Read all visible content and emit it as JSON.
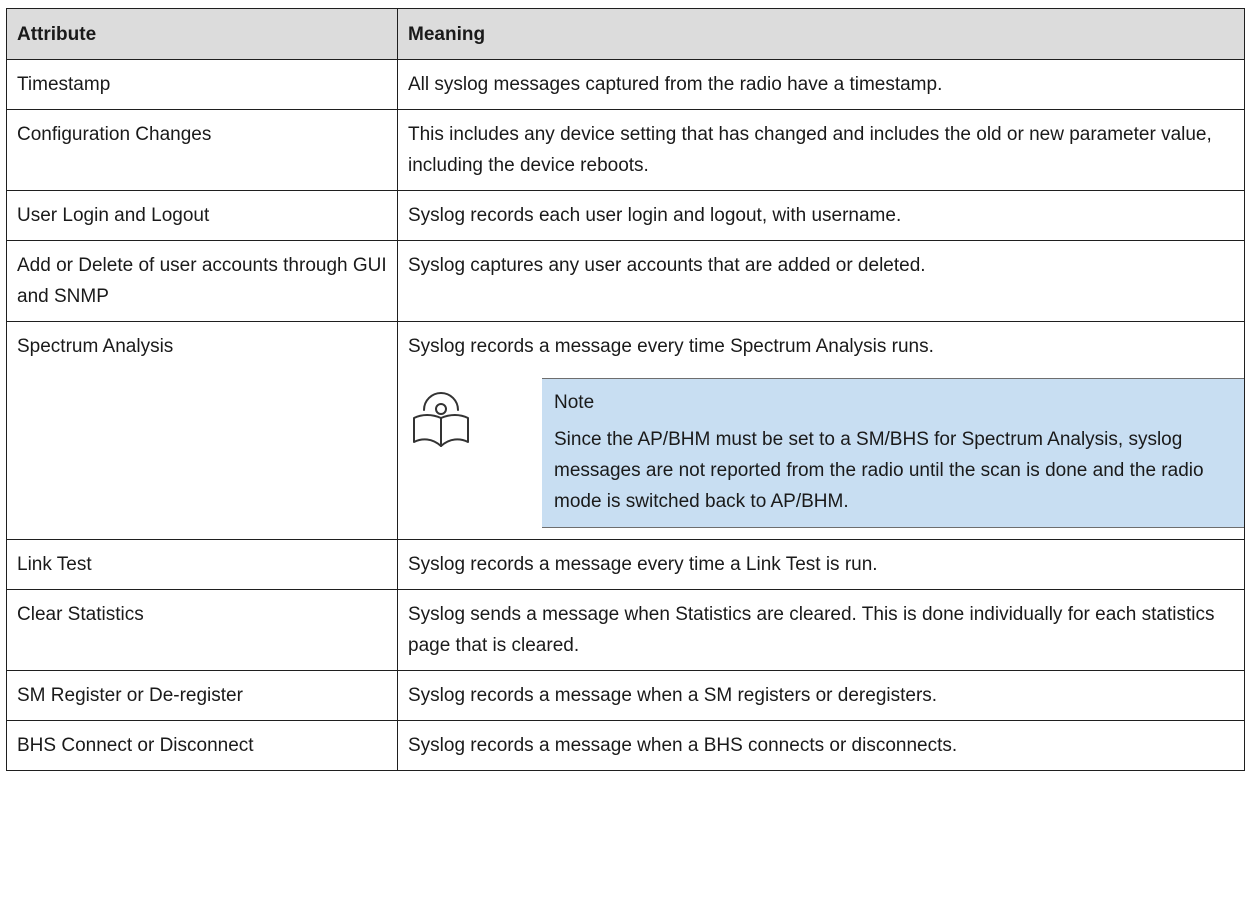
{
  "table": {
    "headers": [
      "Attribute",
      "Meaning"
    ],
    "rows": [
      {
        "attribute": "Timestamp",
        "meaning": "All syslog messages captured from the radio have a timestamp."
      },
      {
        "attribute": "Configuration Changes",
        "meaning": "This includes any device setting that has changed and includes the old or new parameter value, including the device reboots."
      },
      {
        "attribute": "User Login and Logout",
        "meaning": "Syslog records each user login and logout, with username."
      },
      {
        "attribute": "Add or Delete of user accounts through GUI and SNMP",
        "meaning": "Syslog captures any user accounts that are added or deleted."
      },
      {
        "attribute": "Spectrum Analysis",
        "meaning": "Syslog records a message every time Spectrum Analysis runs.",
        "note": {
          "title": "Note",
          "text": "Since the AP/BHM must be set to a SM/BHS for Spectrum Analysis, syslog messages are not reported from the radio until the scan is done and the radio mode is switched back to AP/BHM.",
          "icon": "note-book-icon"
        }
      },
      {
        "attribute": "Link Test",
        "meaning": "Syslog records a message every time a Link Test is run."
      },
      {
        "attribute": "Clear Statistics",
        "meaning": "Syslog sends a message when Statistics are cleared. This is done individually for each statistics page that is cleared."
      },
      {
        "attribute": "SM Register or De-register",
        "meaning": "Syslog records a message when a SM registers or deregisters."
      },
      {
        "attribute": "BHS Connect or Disconnect",
        "meaning": "Syslog records a message when a BHS connects or disconnects."
      }
    ]
  }
}
